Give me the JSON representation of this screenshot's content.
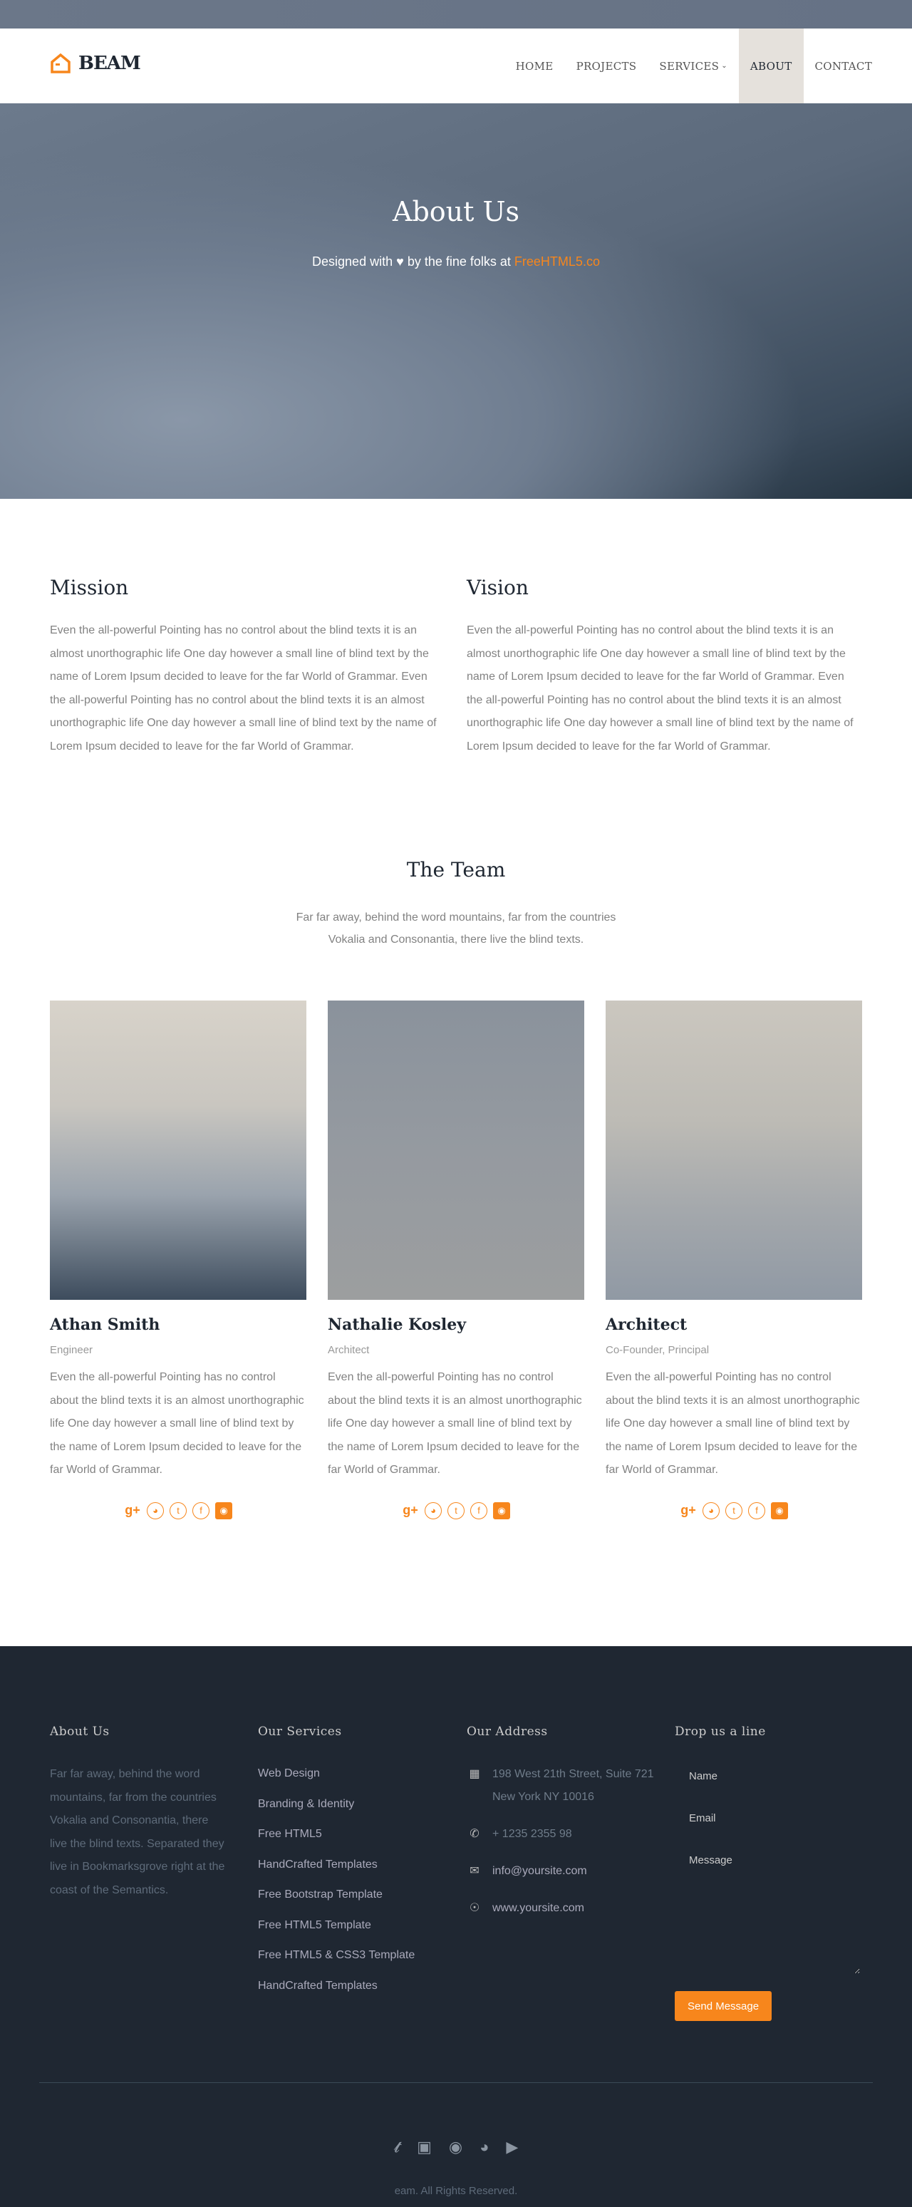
{
  "brand": {
    "name": "BEAM",
    "accent": "#f7861c",
    "dark": "#1f2732"
  },
  "nav": {
    "items": [
      "HOME",
      "PROJECTS",
      "SERVICES",
      "ABOUT",
      "CONTACT"
    ],
    "active": "ABOUT"
  },
  "hero": {
    "title": "About Us",
    "subtitle_pre": "Designed with",
    "subtitle_mid": "by the fine folks at",
    "subtitle_link": "FreeHTML5.co"
  },
  "mission": {
    "title": "Mission",
    "text": "Even the all-powerful Pointing has no control about the blind texts it is an almost unorthographic life One day however a small line of blind text by the name of Lorem Ipsum decided to leave for the far World of Grammar. Even the all-powerful Pointing has no control about the blind texts it is an almost unorthographic life One day however a small line of blind text by the name of Lorem Ipsum decided to leave for the far World of Grammar."
  },
  "vision": {
    "title": "Vision",
    "text": "Even the all-powerful Pointing has no control about the blind texts it is an almost unorthographic life One day however a small line of blind text by the name of Lorem Ipsum decided to leave for the far World of Grammar. Even the all-powerful Pointing has no control about the blind texts it is an almost unorthographic life One day however a small line of blind text by the name of Lorem Ipsum decided to leave for the far World of Grammar."
  },
  "team": {
    "title": "The Team",
    "subtitle": "Far far away, behind the word mountains, far from the countries Vokalia and Consonantia, there live the blind texts.",
    "members": [
      {
        "name": "Athan Smith",
        "role": "Engineer",
        "bio": "Even the all-powerful Pointing has no control about the blind texts it is an almost unorthographic life One day however a small line of blind text by the name of Lorem Ipsum decided to leave for the far World of Grammar."
      },
      {
        "name": "Nathalie Kosley",
        "role": "Architect",
        "bio": "Even the all-powerful Pointing has no control about the blind texts it is an almost unorthographic life One day however a small line of blind text by the name of Lorem Ipsum decided to leave for the far World of Grammar."
      },
      {
        "name": "Architect",
        "role": "Co-Founder, Principal",
        "bio": "Even the all-powerful Pointing has no control about the blind texts it is an almost unorthographic life One day however a small line of blind text by the name of Lorem Ipsum decided to leave for the far World of Grammar."
      }
    ],
    "social_icons": [
      "google-plus-icon",
      "dribbble-icon",
      "twitter-icon",
      "facebook-icon",
      "instagram-icon"
    ]
  },
  "footer": {
    "about": {
      "title": "About Us",
      "text": "Far far away, behind the word mountains, far from the countries Vokalia and Consonantia, there live the blind texts. Separated they live in Bookmarksgrove right at the coast of the Semantics."
    },
    "services": {
      "title": "Our Services",
      "items": [
        "Web Design",
        "Branding & Identity",
        "Free HTML5",
        "HandCrafted Templates",
        "Free Bootstrap Template",
        "Free HTML5 Template",
        "Free HTML5 & CSS3 Template",
        "HandCrafted Templates"
      ]
    },
    "address": {
      "title": "Our Address",
      "street": "198 West 21th Street, Suite 721 New York NY 10016",
      "phone": "+ 1235 2355 98",
      "email": "info@yoursite.com",
      "web": "www.yoursite.com"
    },
    "form": {
      "title": "Drop us a line",
      "name_placeholder": "Name",
      "email_placeholder": "Email",
      "message_placeholder": "Message",
      "submit": "Send Message"
    },
    "social_icons": [
      "twitter-icon",
      "facebook-icon",
      "instagram-icon",
      "dribbble-icon",
      "youtube-icon"
    ],
    "copyright": "eam. All Rights Reserved."
  }
}
